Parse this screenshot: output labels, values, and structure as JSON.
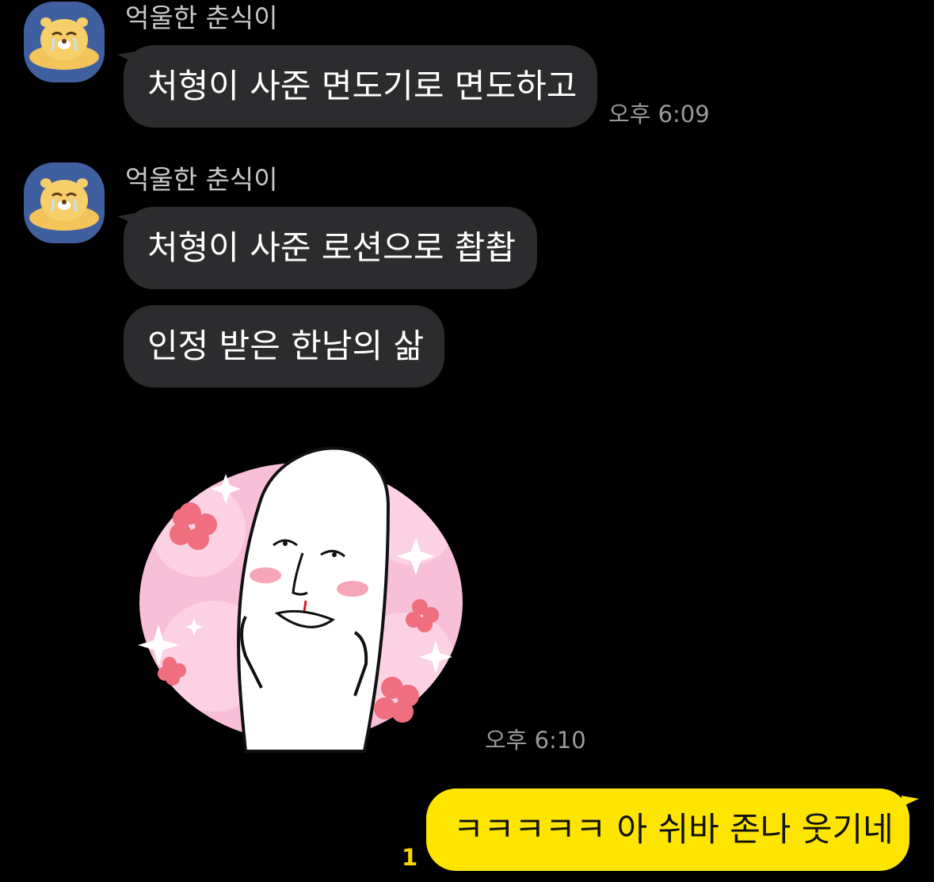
{
  "colors": {
    "background": "#000000",
    "incoming_bubble": "#2c2c2e",
    "outgoing_bubble": "#fee500",
    "unread_badge": "#f7d400",
    "avatar_bg": "#3f5f9e"
  },
  "messages": [
    {
      "sender": "억울한 춘식이",
      "avatar_icon": "choonsik-crying-avatar",
      "text": "처형이 사준 면도기로 면도하고",
      "time": "오후 6:09"
    },
    {
      "sender": "억울한 춘식이",
      "avatar_icon": "choonsik-crying-avatar",
      "texts": [
        "처형이 사준 로션으로 촵촵",
        "인정 받은 한남의 삶"
      ]
    },
    {
      "sticker_icon": "blushing-face-sticker",
      "time": "오후 6:10"
    }
  ],
  "my_message": {
    "text": "ㅋㅋㅋㅋㅋ 아 쉬바 존나 웃기네",
    "unread_count": "1"
  }
}
